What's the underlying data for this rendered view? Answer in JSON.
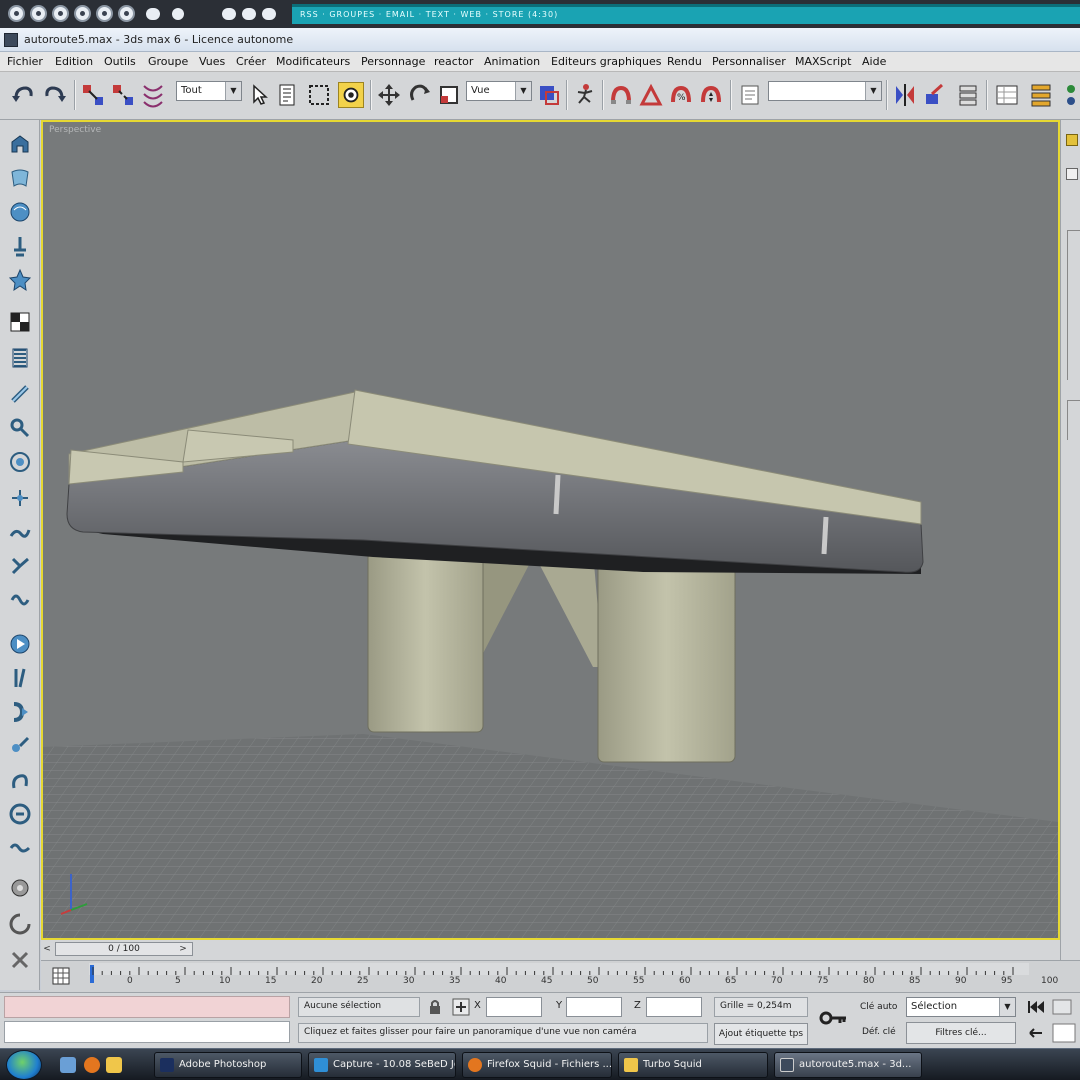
{
  "window": {
    "title": "autoroute5.max - 3ds max 6 - Licence autonome",
    "ticker_text": "RSS · GROUPES · EMAIL · TEXT · WEB · STORE (4:30)"
  },
  "menu": {
    "items": [
      "Fichier",
      "Edition",
      "Outils",
      "Groupe",
      "Vues",
      "Créer",
      "Modificateurs",
      "Personnage",
      "reactor",
      "Animation",
      "Editeurs graphiques",
      "Rendu",
      "Personnaliser",
      "MAXScript",
      "Aide"
    ]
  },
  "toolbar": {
    "selection_filter": "Tout",
    "reference_coord": "Vue",
    "named_selection": ""
  },
  "viewport": {
    "label": "Perspective"
  },
  "timeslider": {
    "frame_display": "0 / 100",
    "prev": "<",
    "next": ">"
  },
  "trackbar": {
    "ticks": [
      "0",
      "5",
      "10",
      "15",
      "20",
      "25",
      "30",
      "35",
      "40",
      "45",
      "50",
      "55",
      "60",
      "65",
      "70",
      "75",
      "80",
      "85",
      "90",
      "95",
      "100"
    ]
  },
  "status": {
    "selection": "Aucune sélection",
    "prompt": "Cliquez et faites glisser pour faire un panoramique d'une vue non caméra",
    "x_label": "X",
    "y_label": "Y",
    "z_label": "Z",
    "grid": "Grille = 0,254m",
    "add_time_tag": "Ajout étiquette tps",
    "auto_key": "Clé auto",
    "set_key": "Déf. clé",
    "key_mode": "Sélection",
    "key_filters": "Filtres clé..."
  },
  "taskbar": {
    "items": [
      {
        "label": "Adobe Photoshop",
        "color": "#1b2f5e"
      },
      {
        "label": "Capture - 10.08 SeBeD Jo...",
        "color": "#2f8fd6"
      },
      {
        "label": "Firefox Squid - Fichiers ...",
        "color": "#e3761f"
      },
      {
        "label": "Turbo Squid",
        "color": "#f0c64a"
      },
      {
        "label": "autoroute5.max - 3d...",
        "color": "#3d4a5c"
      }
    ]
  },
  "colors": {
    "viewport_bg": "#777a7b",
    "active_border": "#e6d832",
    "deck_top": "#c6c6ad",
    "deck_side": "#6b6d72",
    "pillar": "#b9b9a2"
  }
}
